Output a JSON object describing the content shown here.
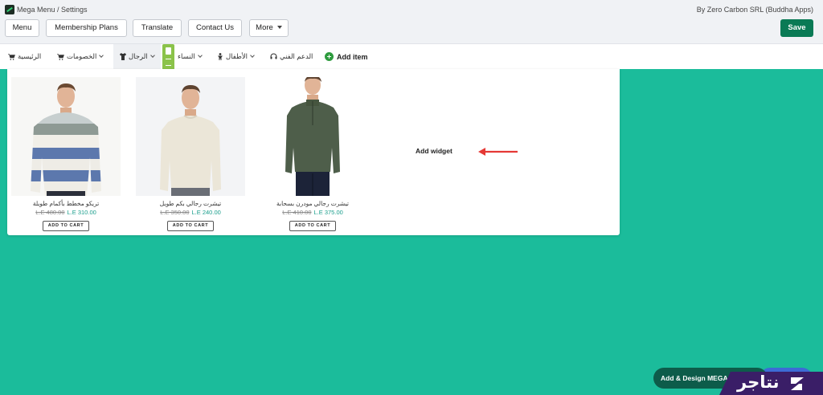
{
  "header": {
    "title": "Mega Menu / Settings",
    "byline": "By Zero Carbon SRL (Buddha Apps)",
    "buttons": {
      "menu": "Menu",
      "membership": "Membership Plans",
      "translate": "Translate",
      "contact": "Contact Us",
      "more": "More"
    },
    "save": "Save"
  },
  "nav": {
    "home": "الرئيسية",
    "offers": "الخصومات",
    "men": "الرجال",
    "women": "النساء",
    "kids": "الأطفال",
    "support": "الدعم الفني",
    "add_item": "Add item"
  },
  "products": [
    {
      "name": "تريكو مخطط بأكمام طويلة",
      "old_price": "L.E 480.00",
      "new_price": "L.E 310.00",
      "cart": "ADD TO CART"
    },
    {
      "name": "تيشرت رجالي بكم طويل",
      "old_price": "L.E 350.00",
      "new_price": "L.E 240.00",
      "cart": "ADD TO CART"
    },
    {
      "name": "تيشرت رجالي مودرن بسحابة",
      "old_price": "L.E 410.00",
      "new_price": "L.E 375.00",
      "cart": "ADD TO CART"
    }
  ],
  "widget": {
    "label": "Add widget"
  },
  "footer": {
    "design_button": "Add & Design MEGA",
    "watermark": "نتاجر"
  },
  "colors": {
    "background": "#1bbc9b",
    "save": "#0a7a55",
    "accent_price": "#1a9e8c",
    "arrow": "#e53935"
  }
}
